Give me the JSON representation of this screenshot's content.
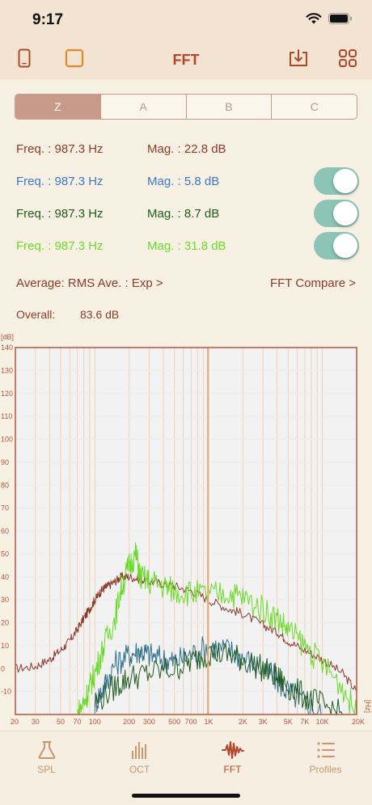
{
  "status": {
    "time": "9:17"
  },
  "nav": {
    "title": "FFT",
    "left_icons": [
      "phone-icon",
      "square-icon"
    ],
    "right_icons": [
      "download-icon",
      "grid-icon"
    ]
  },
  "weighting": {
    "options": [
      "Z",
      "A",
      "B",
      "C"
    ],
    "selected": "Z"
  },
  "readouts": [
    {
      "freq": "Freq. : 987.3 Hz",
      "mag": "Mag. : 22.8 dB",
      "freq_color": "#8b3b2a",
      "mag_color": "#8b3b2a",
      "toggle": false
    },
    {
      "freq": "Freq. : 987.3 Hz",
      "mag": "Mag. : 5.8 dB",
      "freq_color": "#3c78c8",
      "mag_color": "#3c78c8",
      "toggle": true,
      "toggle_on": true
    },
    {
      "freq": "Freq. : 987.3 Hz",
      "mag": "Mag. : 8.7 dB",
      "freq_color": "#1f5a1f",
      "mag_color": "#1f5a1f",
      "toggle": true,
      "toggle_on": true
    },
    {
      "freq": "Freq. : 987.3 Hz",
      "mag": "Mag. : 31.8 dB",
      "freq_color": "#6adb2a",
      "mag_color": "#6adb2a",
      "toggle": true,
      "toggle_on": true
    }
  ],
  "links": {
    "average": "Average: RMS Ave. : Exp >",
    "compare": "FFT Compare >"
  },
  "overall": {
    "label": "Overall:",
    "value": "83.6 dB"
  },
  "chart_data": {
    "type": "line",
    "ylabel": "[dB]",
    "xlabel": "[Hz]",
    "x_scale": "log",
    "xlim": [
      20,
      20000
    ],
    "ylim": [
      -20,
      140
    ],
    "y_ticks": [
      130,
      120,
      110,
      100,
      90,
      80,
      70,
      60,
      50,
      40,
      30,
      20,
      10,
      0,
      -10
    ],
    "y_top_label": "140",
    "x_ticks": [
      {
        "v": 20,
        "label": "20"
      },
      {
        "v": 30,
        "label": "30"
      },
      {
        "v": 50,
        "label": "50"
      },
      {
        "v": 70,
        "label": "70"
      },
      {
        "v": 100,
        "label": "100"
      },
      {
        "v": 200,
        "label": "200"
      },
      {
        "v": 300,
        "label": "300"
      },
      {
        "v": 500,
        "label": "500"
      },
      {
        "v": 700,
        "label": "700"
      },
      {
        "v": 1000,
        "label": "1K"
      },
      {
        "v": 2000,
        "label": "2K"
      },
      {
        "v": 3000,
        "label": "3K"
      },
      {
        "v": 5000,
        "label": "5K"
      },
      {
        "v": 7000,
        "label": "7K"
      },
      {
        "v": 10000,
        "label": "10K"
      },
      {
        "v": 20000,
        "label": "20K"
      }
    ],
    "cursor_hz": 987.3,
    "grid": true,
    "series": [
      {
        "color": "#8b3b2a",
        "x": [
          20,
          30,
          40,
          50,
          60,
          70,
          80,
          90,
          100,
          110,
          120,
          130,
          150,
          170,
          200,
          250,
          300,
          400,
          500,
          700,
          1000,
          1500,
          2000,
          3000,
          4000,
          5000,
          7000,
          10000,
          15000,
          20000
        ],
        "y": [
          0,
          1,
          4,
          8,
          12,
          17,
          22,
          26,
          30,
          33,
          35,
          36,
          38,
          40,
          40,
          39,
          38,
          37,
          36,
          34,
          30,
          26,
          24,
          19,
          16,
          12,
          8,
          4,
          -2,
          -10
        ]
      },
      {
        "color": "#2e6f8e",
        "x": [
          100,
          120,
          150,
          200,
          250,
          300,
          400,
          500,
          700,
          1000,
          1500,
          2000,
          3000,
          4000,
          5000,
          7000,
          10000
        ],
        "y": [
          -15,
          -8,
          2,
          6,
          8,
          6,
          4,
          3,
          6,
          10,
          8,
          5,
          0,
          -5,
          -10,
          -15,
          -20
        ]
      },
      {
        "color": "#1f5a1f",
        "x": [
          100,
          150,
          200,
          300,
          500,
          700,
          1000,
          1500,
          2000,
          3000,
          4000,
          5000,
          7000,
          10000,
          15000
        ],
        "y": [
          -15,
          -8,
          -4,
          -2,
          0,
          3,
          7,
          6,
          4,
          0,
          -4,
          -8,
          -12,
          -16,
          -20
        ]
      },
      {
        "color": "#6adb2a",
        "x": [
          70,
          80,
          90,
          100,
          120,
          150,
          170,
          200,
          230,
          250,
          300,
          400,
          500,
          700,
          1000,
          1500,
          2000,
          3000,
          4000,
          5000,
          7000,
          10000,
          15000,
          20000
        ],
        "y": [
          -20,
          -15,
          -8,
          -2,
          10,
          22,
          35,
          45,
          50,
          40,
          38,
          36,
          34,
          33,
          32,
          33,
          31,
          26,
          22,
          17,
          10,
          2,
          -8,
          -20
        ]
      }
    ]
  },
  "tabs": [
    {
      "label": "SPL",
      "icon": "flask-icon",
      "active": false
    },
    {
      "label": "OCT",
      "icon": "bars-icon",
      "active": false
    },
    {
      "label": "FFT",
      "icon": "waveform-icon",
      "active": true
    },
    {
      "label": "Profiles",
      "icon": "list-icon",
      "active": false
    }
  ]
}
